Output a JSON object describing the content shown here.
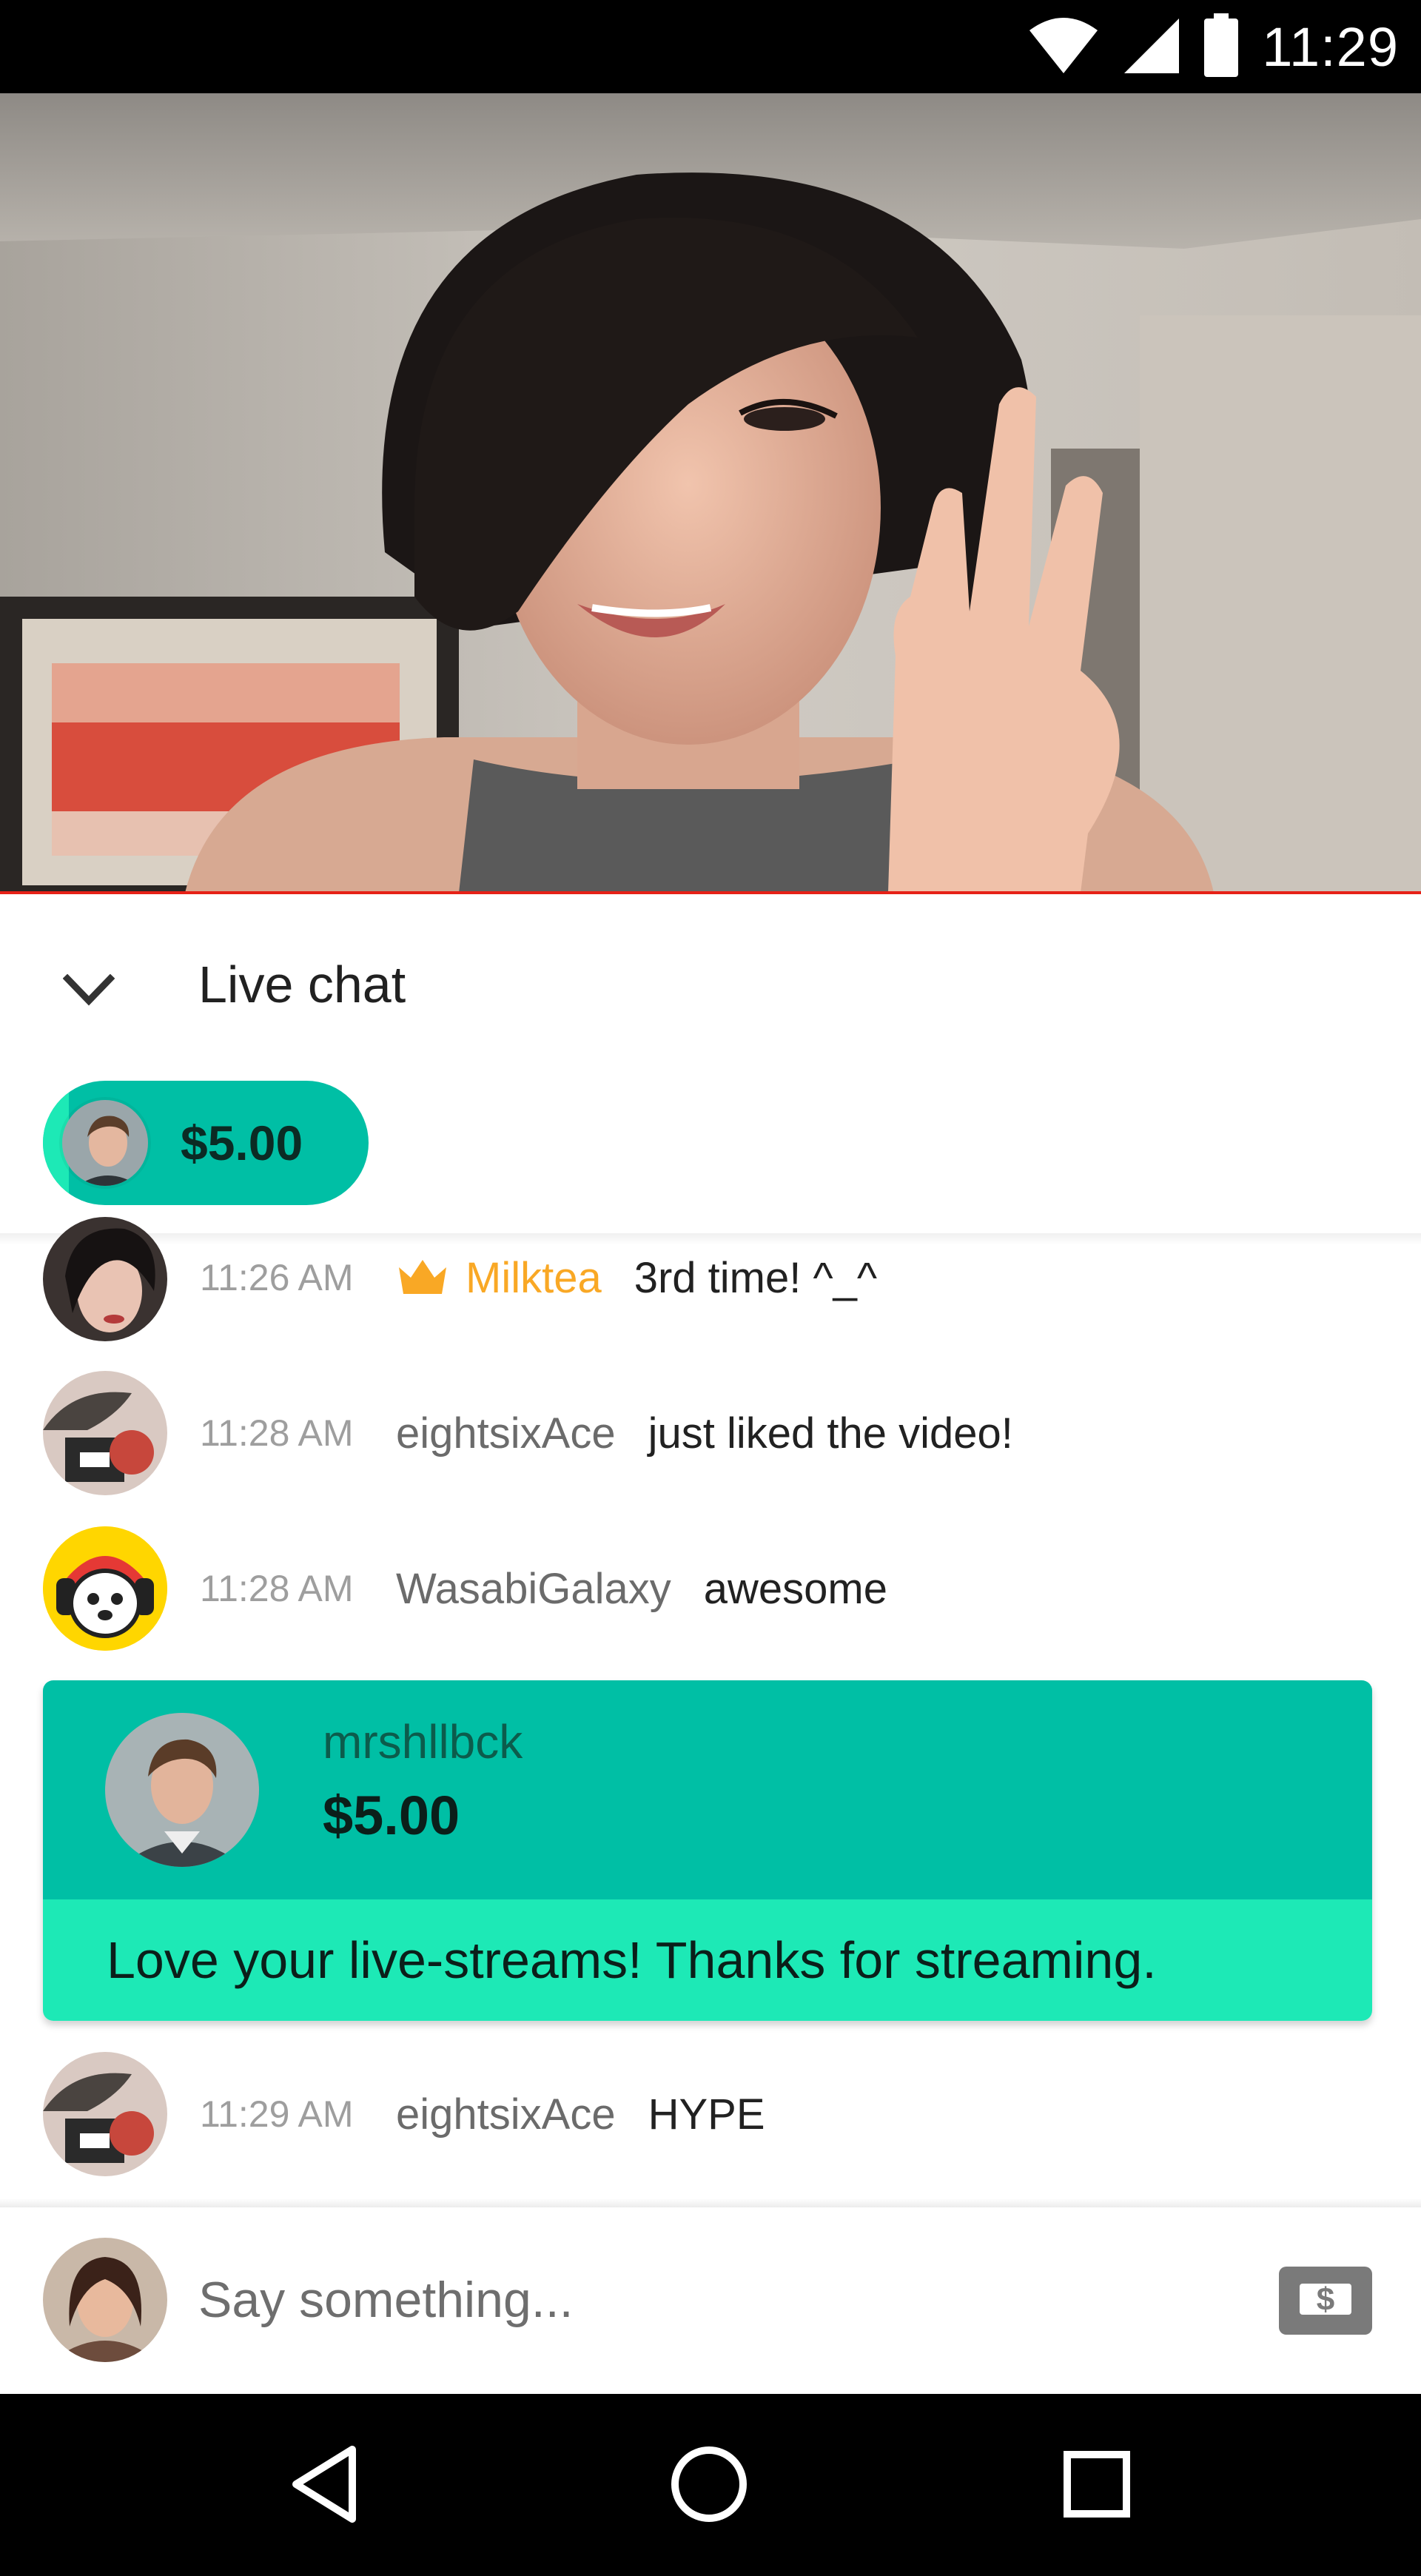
{
  "status_bar": {
    "time": "11:29",
    "icons": [
      "wifi-icon",
      "cell-signal-icon",
      "battery-icon"
    ]
  },
  "video": {
    "description_icon": "live-video"
  },
  "chat": {
    "title": "Live chat",
    "collapse_icon": "chevron-down-icon",
    "ticker": {
      "amount": "$5.00",
      "fill_fraction": 0.08
    },
    "messages": [
      {
        "time": "11:26 AM",
        "author": "Milktea",
        "badge": "crown-icon",
        "text": "3rd time! ^_^"
      },
      {
        "time": "11:28 AM",
        "author": "eightsixAce",
        "text": "just liked the video!"
      },
      {
        "time": "11:28 AM",
        "author": "WasabiGalaxy",
        "text": "awesome"
      },
      {
        "time": "11:29 AM",
        "author": "eightsixAce",
        "text": "HYPE"
      }
    ],
    "superchat": {
      "author": "mrshllbck",
      "amount": "$5.00",
      "message": "Love your live-streams! Thanks for streaming."
    },
    "input": {
      "placeholder": "Say something...",
      "super_chat_icon": "dollar-icon"
    }
  },
  "nav": {
    "icons": [
      "back-icon",
      "home-icon",
      "recents-icon"
    ]
  },
  "colors": {
    "accent_red": "#e62117",
    "superchat_dark": "#00bfa5",
    "superchat_light": "#1de9b6",
    "crown_gold": "#f9a825",
    "author_gold": "#f9a825"
  }
}
